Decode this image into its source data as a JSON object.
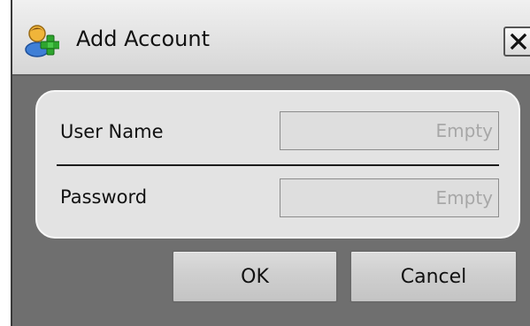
{
  "window": {
    "title": "Add Account",
    "icon": "add-user-icon",
    "close_icon": "close-icon"
  },
  "form": {
    "username": {
      "label": "User Name",
      "placeholder": "Empty",
      "value": ""
    },
    "password": {
      "label": "Password",
      "placeholder": "Empty",
      "value": ""
    }
  },
  "buttons": {
    "ok": "OK",
    "cancel": "Cancel"
  },
  "colors": {
    "frame": "#6f6f6f",
    "panel": "#e3e3e3",
    "titlebar": "#e6e6e6",
    "placeholder": "#a7a7a7"
  }
}
